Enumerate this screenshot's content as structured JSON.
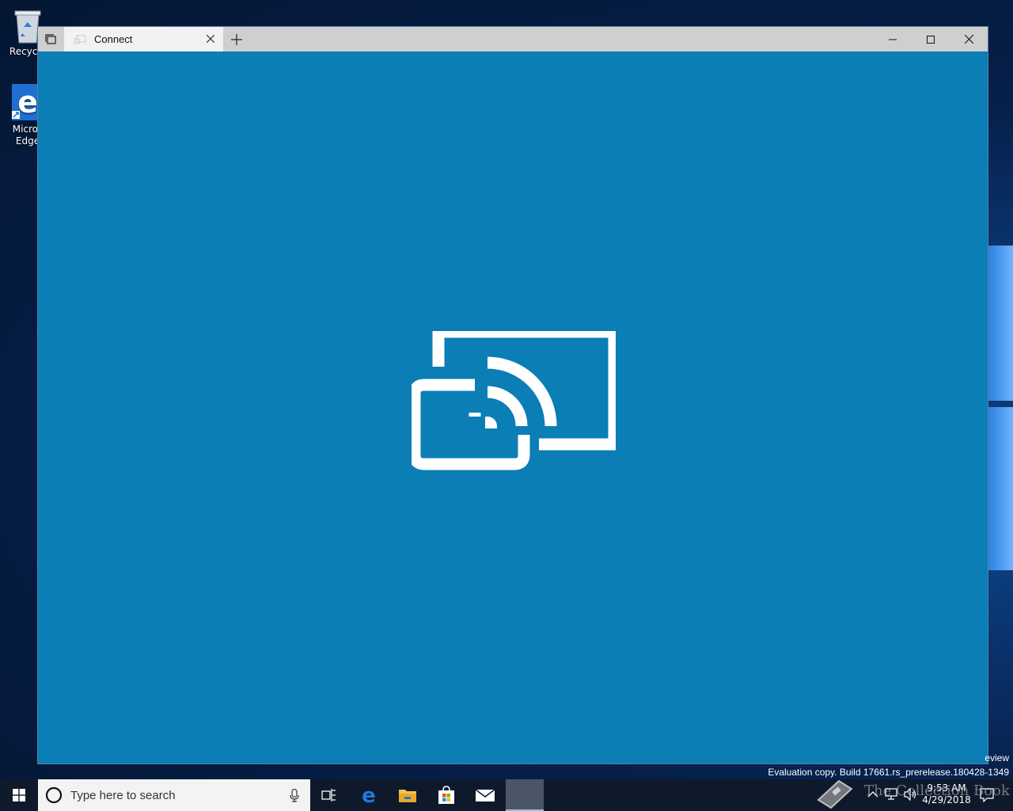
{
  "desktop": {
    "icons": [
      {
        "label": "Recycle",
        "icon": "recycle-bin-icon"
      },
      {
        "label_line1": "Micros",
        "label_line2": "Edge",
        "icon": "edge-icon"
      }
    ]
  },
  "window": {
    "tab_title": "Connect",
    "new_tab_symbol": "+",
    "content_icon": "cast-screen-icon",
    "colors": {
      "content_bg": "#0a7eb5",
      "titlebar_bg": "#cfcfcf"
    }
  },
  "watermark": {
    "line1": "eview",
    "line2": "Evaluation copy. Build 17661.rs_prerelease.180428-1349"
  },
  "taskbar": {
    "search_placeholder": "Type here to search",
    "pinned": [
      "task-view-icon",
      "edge-icon",
      "file-explorer-icon",
      "store-icon",
      "mail-icon",
      "connect-app-icon"
    ],
    "clock_time": "9:53 AM",
    "clock_date": "4/29/2018",
    "overlay_text": "The Collection Book"
  }
}
